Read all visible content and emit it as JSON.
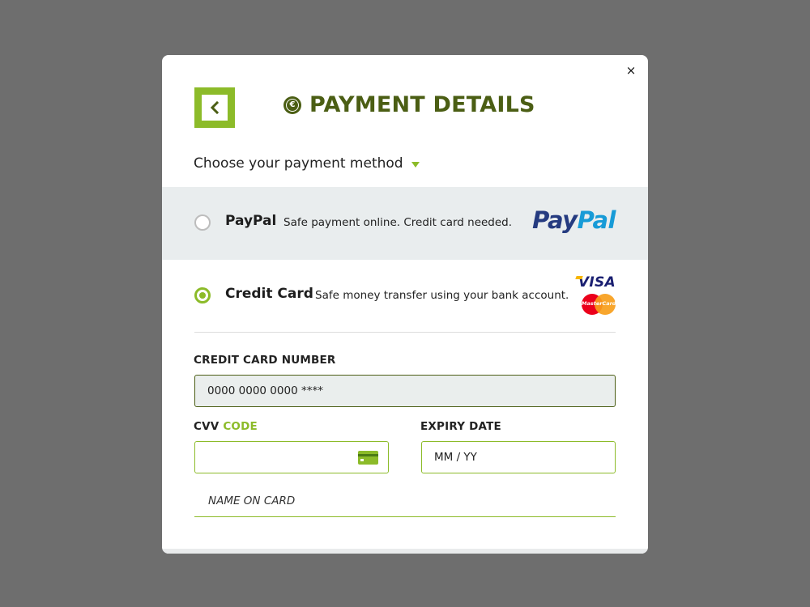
{
  "modal": {
    "close_label": "×",
    "title": "PAYMENT DETAILS",
    "choose_label": "Choose your payment method",
    "accent_color": "#8cbb29",
    "dark_green": "#4b5e14"
  },
  "methods": {
    "paypal": {
      "name": "PayPal",
      "description": "Safe payment online. Credit card needed.",
      "logo_part1": "Pay",
      "logo_part2": "Pal",
      "selected": false
    },
    "card": {
      "name": "Credit Card",
      "description": "Safe money transfer using your bank account.",
      "visa_logo": "VISA",
      "mastercard_logo": "MasterCard",
      "selected": true
    }
  },
  "form": {
    "card_number_label": "CREDIT CARD NUMBER",
    "card_number_value": "0000 0000 0000 ****",
    "cvv_label": "CVV",
    "cvv_label_accent": "CODE",
    "cvv_value": "",
    "expiry_label": "EXPIRY DATE",
    "expiry_placeholder": "MM / YY",
    "name_placeholder": "NAME ON CARD"
  }
}
